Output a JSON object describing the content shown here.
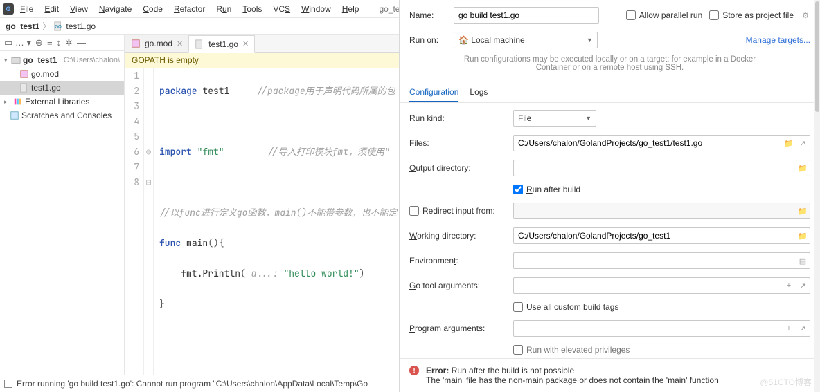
{
  "menu": {
    "items": [
      "File",
      "Edit",
      "View",
      "Navigate",
      "Code",
      "Refactor",
      "Run",
      "Tools",
      "VCS",
      "Window",
      "Help"
    ],
    "tail": "go_test"
  },
  "breadcrumb": {
    "project": "go_test1",
    "file": "test1.go"
  },
  "toolstrip": {
    "dots": "…",
    "plus": "⊕",
    "filter": "≡",
    "sort": "↕",
    "gear": "✲",
    "minus": "—"
  },
  "tree": {
    "project_name": "go_test1",
    "project_path": "C:\\Users\\chalon\\",
    "gomod": "go.mod",
    "test1": "test1.go",
    "ext": "External Libraries",
    "scratch": "Scratches and Consoles"
  },
  "tabs": {
    "gomod": "go.mod",
    "test1": "test1.go"
  },
  "banner": "GOPATH is empty",
  "code": {
    "lines": [
      "1",
      "2",
      "3",
      "4",
      "5",
      "6",
      "7",
      "8"
    ],
    "l1_kw": "package ",
    "l1_id": "test1",
    "l1_c": "//package用于声明代码所属的包",
    "l3_kw": "import ",
    "l3_str": "\"fmt\"",
    "l3_c": "//导入打印模块fmt，须使用\"",
    "l5_c": "//以func进行定义go函数，main()不能带参数，也不能定",
    "l6_kw": "func ",
    "l6_id": "main",
    "l6_p": "(){",
    "l7_pre": "    fmt.",
    "l7_fn": "Println",
    "l7_p": "( ",
    "l7_hint": "a...: ",
    "l7_str": "\"hello world!\"",
    "l7_p2": ")",
    "l8": "}"
  },
  "status": "Error running 'go build test1.go': Cannot run program \"C:\\Users\\chalon\\AppData\\Local\\Temp\\Go",
  "dialog": {
    "name_label": "Name:",
    "name_value": "go build test1.go",
    "allow_parallel": "Allow parallel run",
    "store_as": "Store as project file",
    "runon_label": "Run on:",
    "runon_value": "Local machine",
    "manage": "Manage targets...",
    "hint": "Run configurations may be executed locally or on a target: for example in a Docker Container or on a remote host using SSH.",
    "tab_config": "Configuration",
    "tab_logs": "Logs",
    "f_runkind": "Run kind:",
    "v_runkind": "File",
    "f_files": "Files:",
    "v_files": "C:/Users/chalon/GolandProjects/go_test1/test1.go",
    "f_outdir": "Output directory:",
    "chk_runafter": "Run after build",
    "chk_redirect": "Redirect input from:",
    "f_workdir": "Working directory:",
    "v_workdir": "C:/Users/chalon/GolandProjects/go_test1",
    "f_env": "Environment:",
    "f_gotool": "Go tool arguments:",
    "chk_custom": "Use all custom build tags",
    "f_prog": "Program arguments:",
    "chk_elevated": "Run with elevated privileges",
    "err_title": "Error:",
    "err_l1": "Run after the build is not possible",
    "err_l2": "The 'main' file has the non-main package or does not contain the 'main' function"
  },
  "watermark": "@51CTO博客",
  "icons": {
    "home": "home-icon",
    "gear": "gear-icon",
    "folder": "folder-icon",
    "expand": "expand-icon",
    "plus": "plus-icon",
    "list": "list-icon"
  }
}
